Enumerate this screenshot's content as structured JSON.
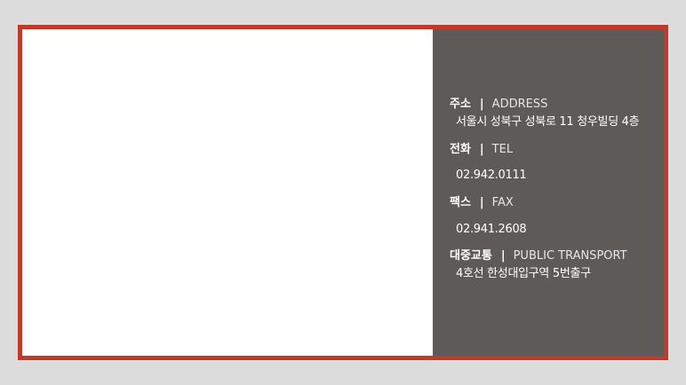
{
  "colors": {
    "page_background": "#dcdcdc",
    "frame_border": "#c0392b",
    "panel_background": "#5d5a58",
    "text": "#ffffff"
  },
  "info": {
    "separator": "|",
    "address": {
      "label_ko": "주소",
      "label_en": "ADDRESS",
      "value": "서울시 성북구 성북로 11 청우빌딩 4층"
    },
    "tel": {
      "label_ko": "전화",
      "label_en": "TEL",
      "value": "02.942.0111"
    },
    "fax": {
      "label_ko": "팩스",
      "label_en": "FAX",
      "value": "02.941.2608"
    },
    "transport": {
      "label_ko": "대중교통",
      "label_en": "PUBLIC TRANSPORT",
      "value": "4호선 한성대입구역 5번출구"
    }
  }
}
